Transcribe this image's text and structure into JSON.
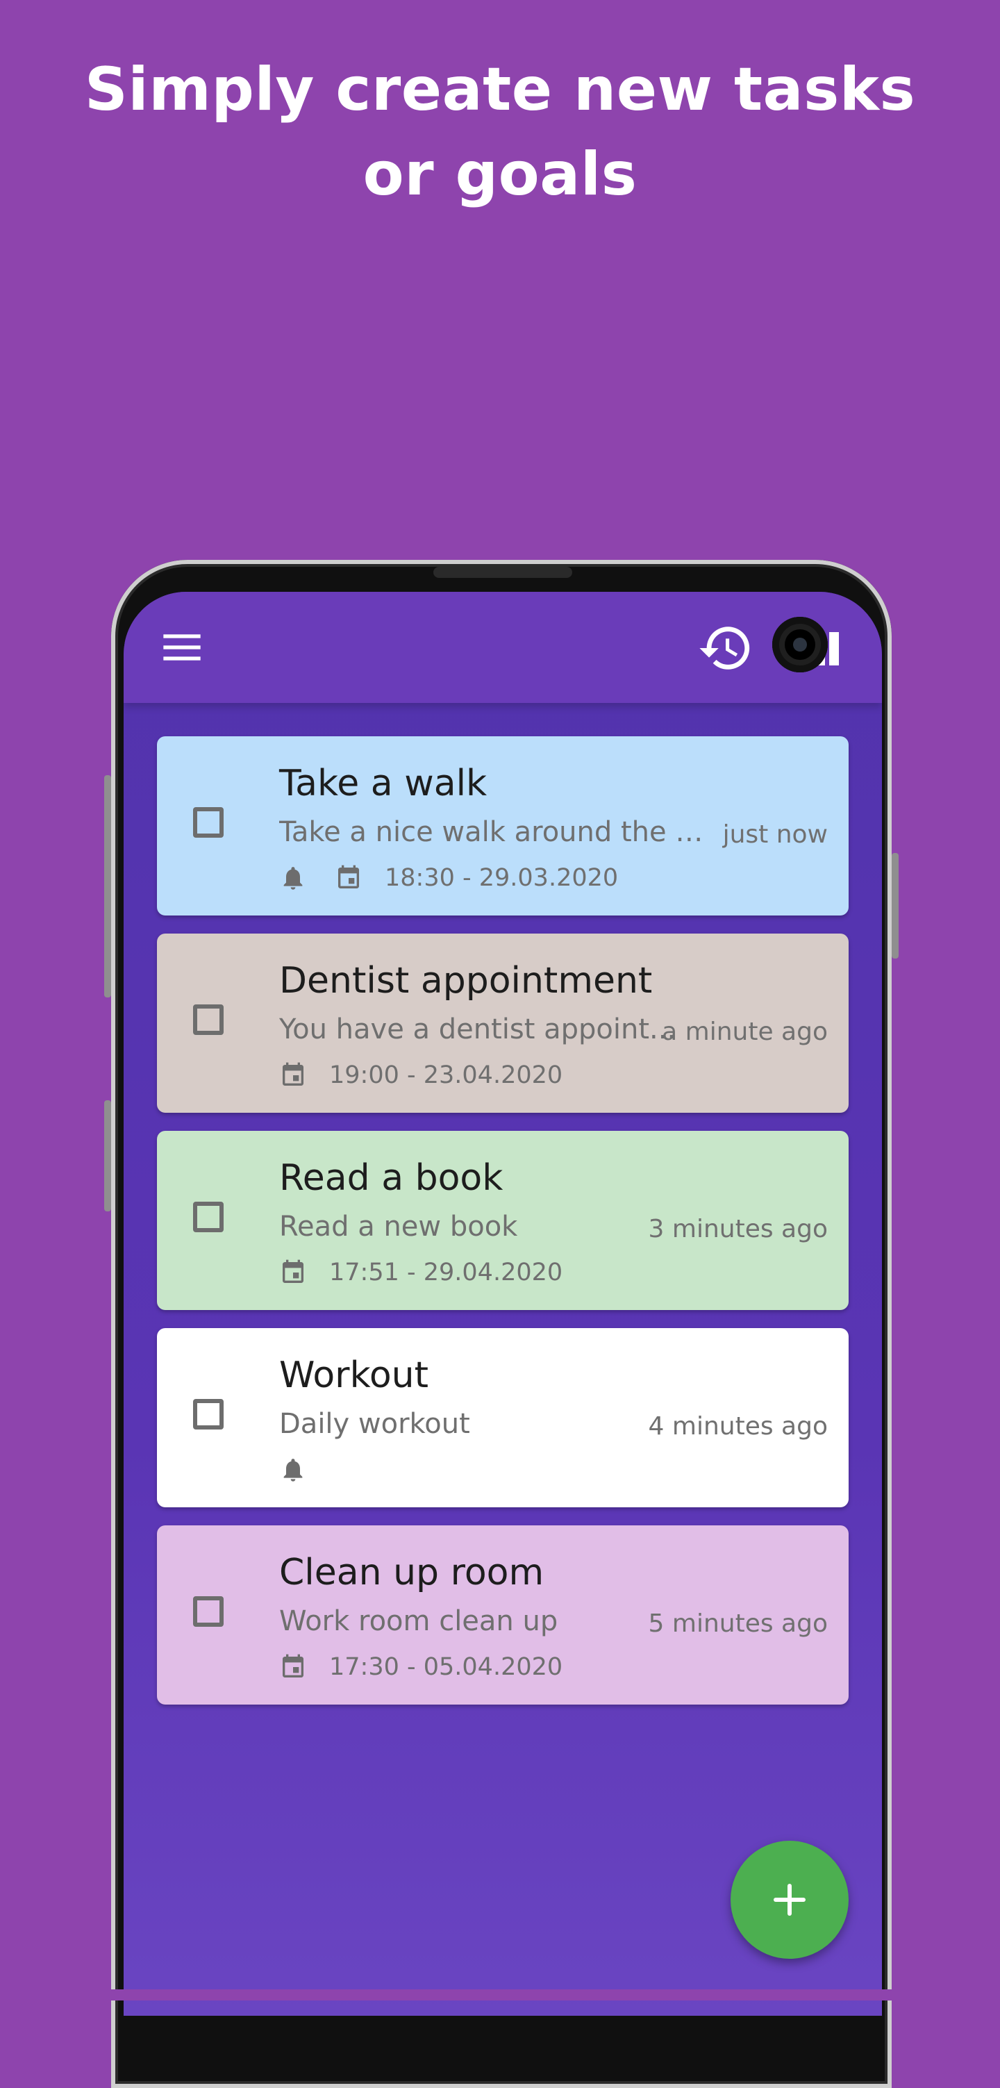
{
  "headline": "Simply create new tasks or goals",
  "colors": {
    "page_background": "#8e44ad",
    "appbar": "#6a3cb9",
    "screen": "#5233ad",
    "fab": "#4caf50"
  },
  "appbar": {
    "menu_icon": "hamburger-menu-icon",
    "history_icon": "history-icon",
    "sort_icon": "sort-icon"
  },
  "tasks": [
    {
      "title": "Take a walk",
      "description": "Take a nice walk around the ne...",
      "created": "just now",
      "date": "18:30 - 29.03.2020",
      "has_reminder": true,
      "has_date": true,
      "color": "#bbdefb"
    },
    {
      "title": "Dentist appointment",
      "description": "You have a dentist appoint...",
      "created": "a minute ago",
      "date": "19:00 - 23.04.2020",
      "has_reminder": false,
      "has_date": true,
      "color": "#d7ccc8"
    },
    {
      "title": "Read a book",
      "description": "Read a new book",
      "created": "3 minutes ago",
      "date": "17:51 - 29.04.2020",
      "has_reminder": false,
      "has_date": true,
      "color": "#c8e6c9"
    },
    {
      "title": "Workout",
      "description": "Daily workout",
      "created": "4 minutes ago",
      "date": "",
      "has_reminder": true,
      "has_date": false,
      "color": "#ffffff"
    },
    {
      "title": "Clean up room",
      "description": "Work room clean up",
      "created": "5 minutes ago",
      "date": "17:30 - 05.04.2020",
      "has_reminder": false,
      "has_date": true,
      "color": "#e1bee7"
    }
  ],
  "fab": {
    "icon": "plus-icon"
  }
}
